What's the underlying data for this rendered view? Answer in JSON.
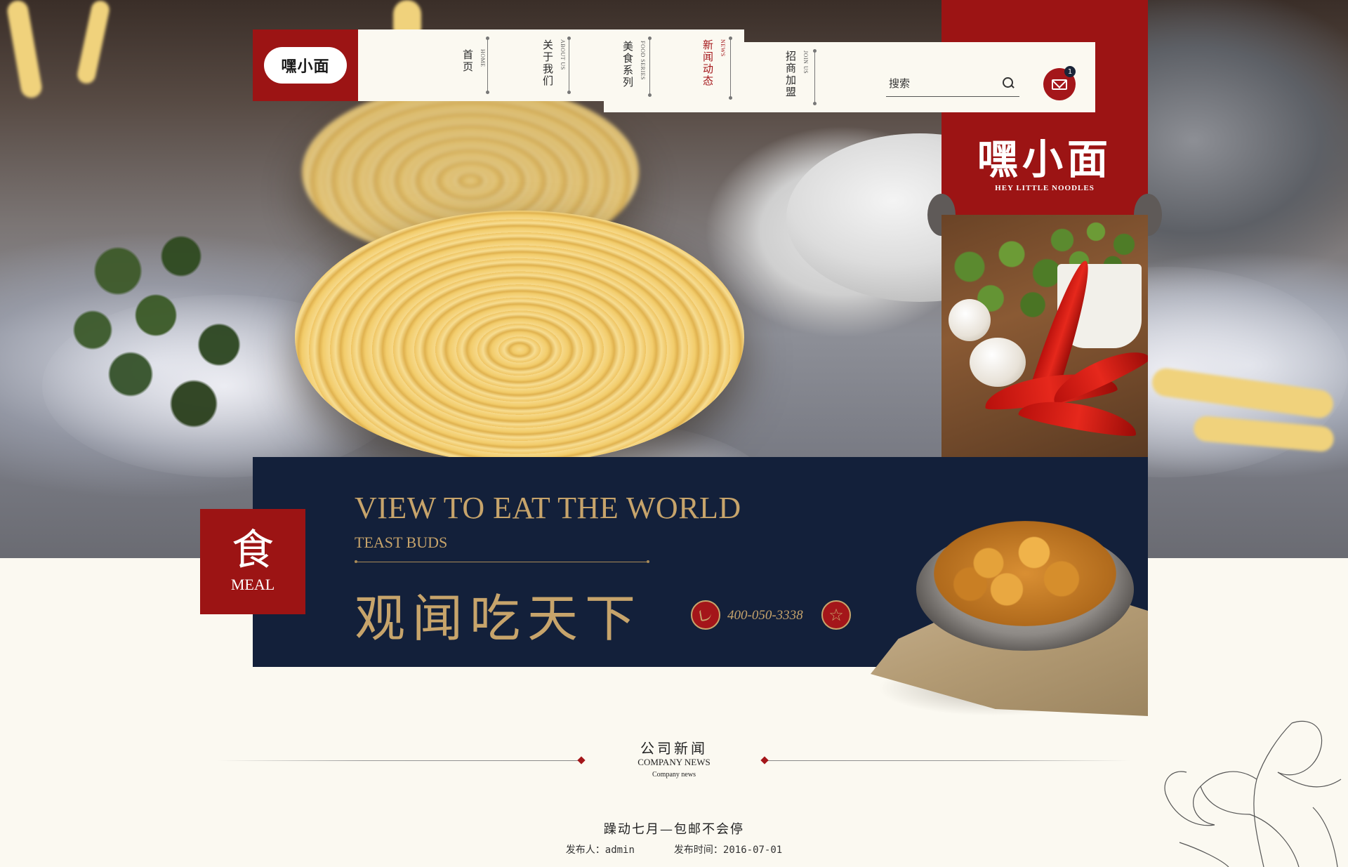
{
  "header": {
    "logo_text": "嘿小面",
    "nav": [
      {
        "cn": "首页",
        "en": "HOME"
      },
      {
        "cn": "关于我们",
        "en": "ABOUT US"
      },
      {
        "cn": "美食系列",
        "en": "FOOD SERIES"
      },
      {
        "cn": "新闻动态",
        "en": "NEWS",
        "active": true
      },
      {
        "cn": "招商加盟",
        "en": "JOIN US"
      }
    ],
    "search_placeholder": "搜索",
    "mail_badge": "1"
  },
  "brand": {
    "cn": "嘿小面",
    "en": "HEY LITTLE NOODLES"
  },
  "banner": {
    "title": "VIEW TO EAT THE WORLD",
    "subtitle": "TEAST BUDS",
    "cn_title": "观闻吃天下",
    "phone": "400-050-3338",
    "star_glyph": "☆"
  },
  "meal_badge": {
    "cn": "食",
    "en": "MEAL"
  },
  "news": {
    "title_cn": "公司新闻",
    "title_en": "COMPANY NEWS",
    "title_sub": "Company news",
    "article": {
      "title": "躁动七月—包邮不会停",
      "author": "发布人：admin",
      "date": "发布时间：2016-07-01"
    }
  },
  "colors": {
    "brand_red": "#9c1414",
    "navy": "#13203a",
    "gold": "#c7a46b",
    "cream": "#fbf9f1"
  },
  "icons": [
    "search-icon",
    "mail-icon",
    "phone-icon",
    "star-icon"
  ]
}
